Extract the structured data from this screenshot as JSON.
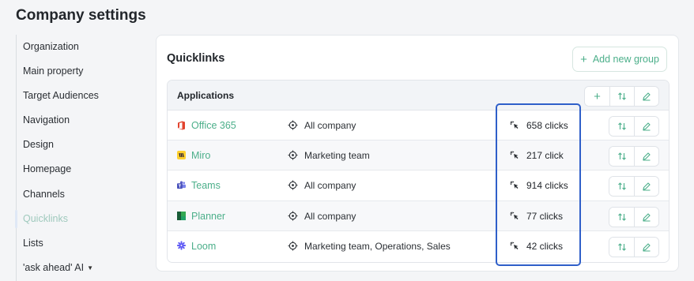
{
  "page": {
    "title": "Company settings"
  },
  "sidebar": {
    "items": [
      {
        "label": "Organization"
      },
      {
        "label": "Main property"
      },
      {
        "label": "Target Audiences"
      },
      {
        "label": "Navigation"
      },
      {
        "label": "Design"
      },
      {
        "label": "Homepage"
      },
      {
        "label": "Channels"
      },
      {
        "label": "Quicklinks",
        "active": true
      },
      {
        "label": "Lists"
      },
      {
        "label": "'ask ahead' AI",
        "icon": "caret-down-icon"
      }
    ]
  },
  "quicklinks": {
    "title": "Quicklinks",
    "add_group_label": "Add new group",
    "group": {
      "name": "Applications",
      "rows": [
        {
          "app": "Office 365",
          "icon": "office365-icon",
          "color": "#e2442f",
          "audience": "All company",
          "clicks": "658 clicks"
        },
        {
          "app": "Miro",
          "icon": "miro-icon",
          "color": "#ffd02f",
          "audience": "Marketing team",
          "clicks": "217 click"
        },
        {
          "app": "Teams",
          "icon": "teams-icon",
          "color": "#5b5fc7",
          "audience": "All company",
          "clicks": "914 clicks"
        },
        {
          "app": "Planner",
          "icon": "planner-icon",
          "color": "#31752f",
          "audience": "All company",
          "clicks": "77 clicks"
        },
        {
          "app": "Loom",
          "icon": "loom-icon",
          "color": "#625df5",
          "audience": "Marketing team, Operations, Sales",
          "clicks": "42 clicks"
        }
      ]
    }
  },
  "colors": {
    "accent": "#4caf8a",
    "highlight": "#2f5fc9"
  }
}
